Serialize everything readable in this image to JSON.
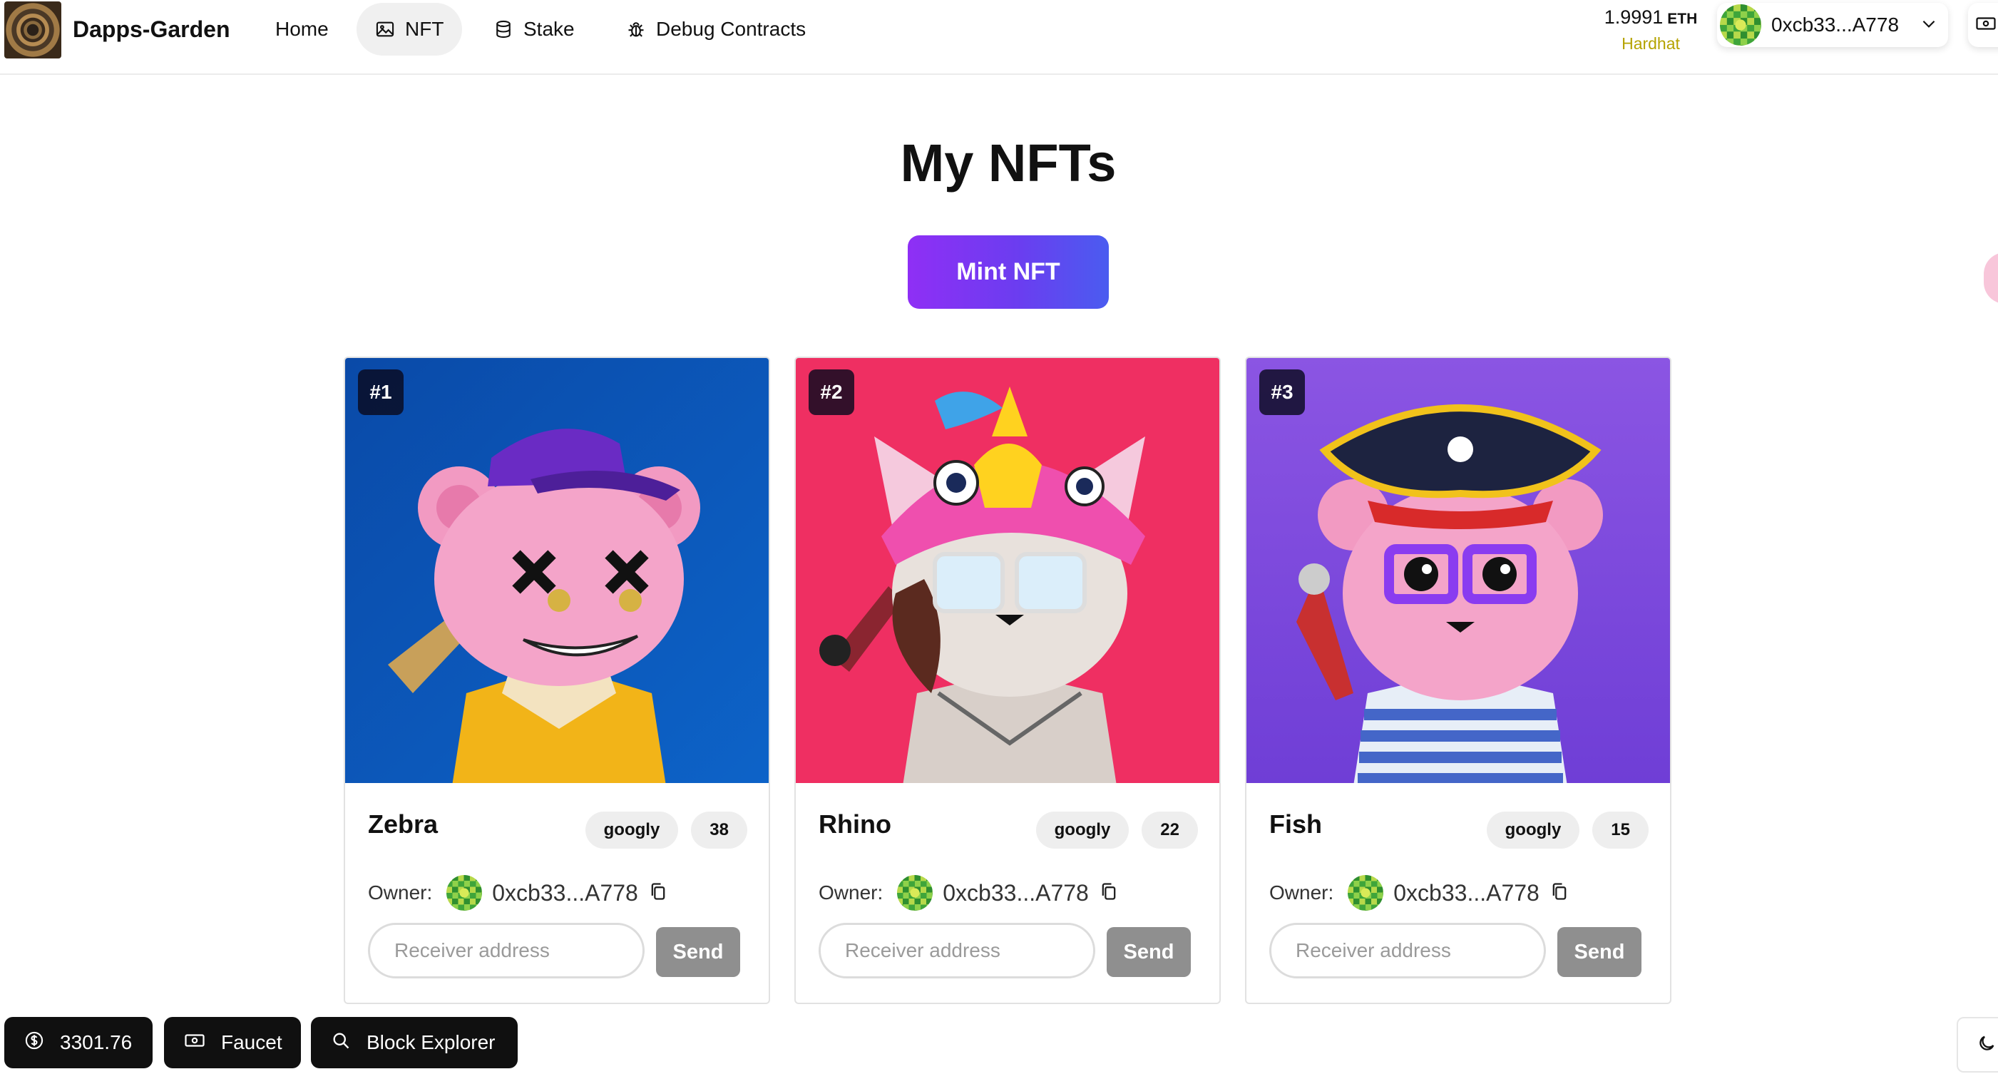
{
  "header": {
    "brand": "Dapps-Garden",
    "nav": [
      {
        "label": "Home",
        "icon": "none"
      },
      {
        "label": "NFT",
        "icon": "image-icon",
        "active": true
      },
      {
        "label": "Stake",
        "icon": "database-icon"
      },
      {
        "label": "Debug Contracts",
        "icon": "bug-icon"
      }
    ],
    "balance": {
      "amount": "1.9991",
      "unit": "ETH"
    },
    "network": "Hardhat",
    "account": {
      "address": "0xcb33...A778",
      "icon": "chevron-down-icon"
    }
  },
  "main": {
    "title": "My NFTs",
    "mint_label": "Mint NFT"
  },
  "cards": [
    {
      "id": "#1",
      "name": "Zebra",
      "tag": "googly",
      "count": "38",
      "owner_label": "Owner:",
      "owner": "0xcb33...A778",
      "input_placeholder": "Receiver address",
      "send_label": "Send"
    },
    {
      "id": "#2",
      "name": "Rhino",
      "tag": "googly",
      "count": "22",
      "owner_label": "Owner:",
      "owner": "0xcb33...A778",
      "input_placeholder": "Receiver address",
      "send_label": "Send"
    },
    {
      "id": "#3",
      "name": "Fish",
      "tag": "googly",
      "count": "15",
      "owner_label": "Owner:",
      "owner": "0xcb33...A778",
      "input_placeholder": "Receiver address",
      "send_label": "Send"
    }
  ],
  "footer": {
    "price": "3301.76",
    "faucet": "Faucet",
    "explorer": "Block Explorer"
  },
  "colors": {
    "mint_gradient_start": "#8f2ff5",
    "mint_gradient_end": "#4a5cf0",
    "network": "#b5a300",
    "send_button": "#8f8f8f",
    "card1_bg": "#0b57b8",
    "card2_bg": "#ee2d63",
    "card3_bg": "#7d4ee0"
  }
}
